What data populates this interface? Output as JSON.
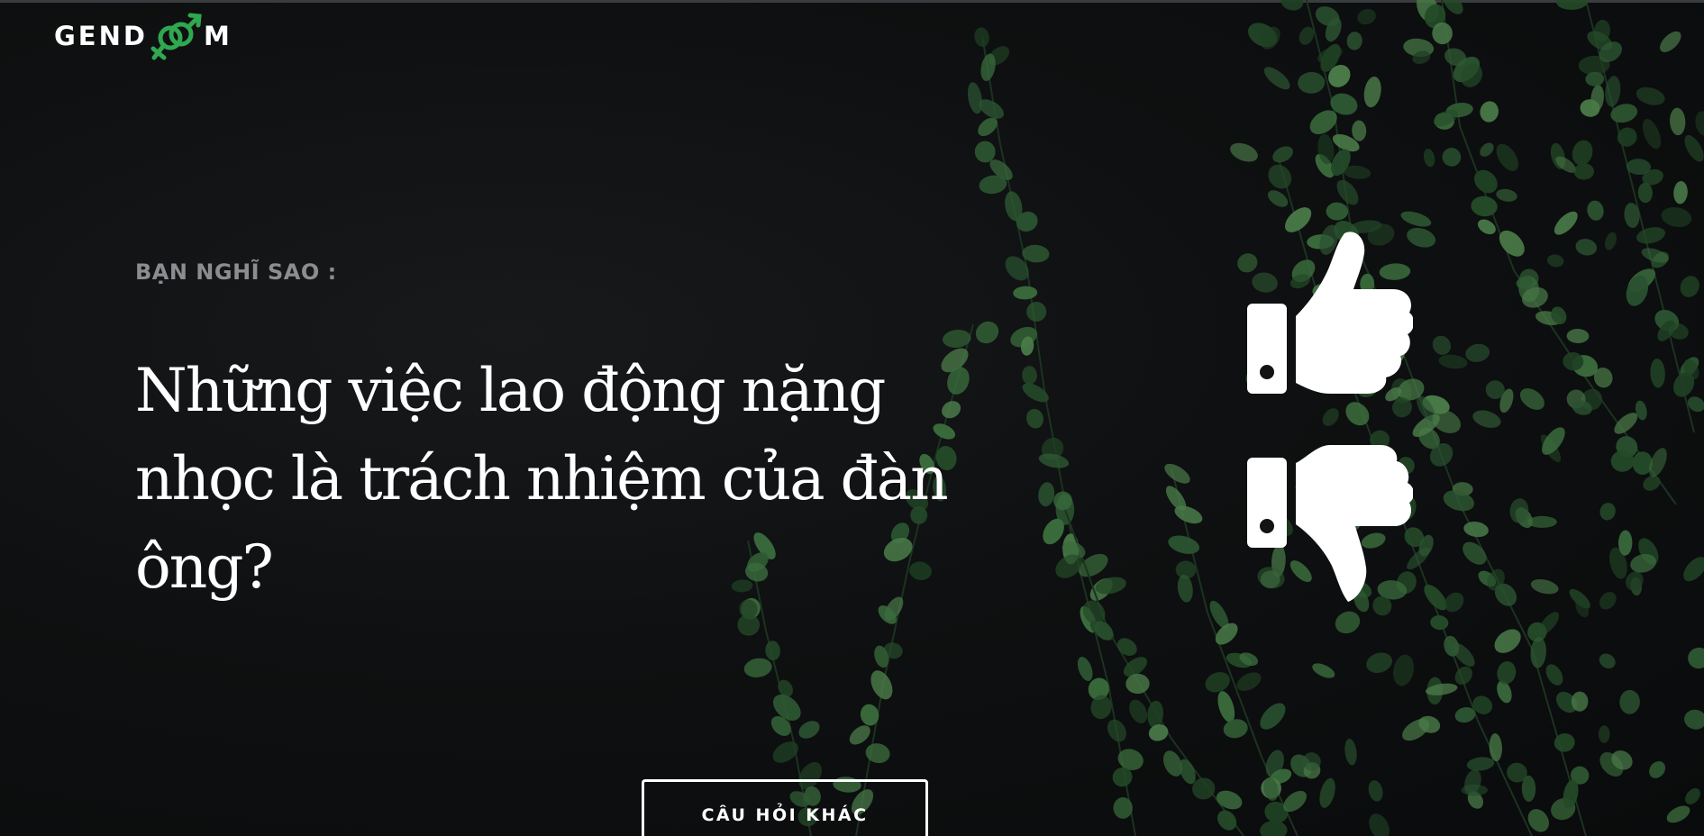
{
  "brand": {
    "logo_left": "GEND",
    "logo_right": "M",
    "logo_mark_icon": "gender-symbols-icon",
    "accent_color": "#2fa84f"
  },
  "prompt": {
    "eyebrow": "BẠN NGHĨ SAO :",
    "question": "Những việc lao động nặng nhọc là trách nhiệm của đàn ông?"
  },
  "votes": {
    "agree_icon": "thumbs-up-icon",
    "disagree_icon": "thumbs-down-icon"
  },
  "actions": {
    "other_question_label": "CÂU HỎI KHÁC"
  },
  "colors": {
    "background": "#0b0d0e",
    "foliage": "#2f5a33",
    "text": "#ffffff",
    "muted_text": "#8b8d90"
  }
}
